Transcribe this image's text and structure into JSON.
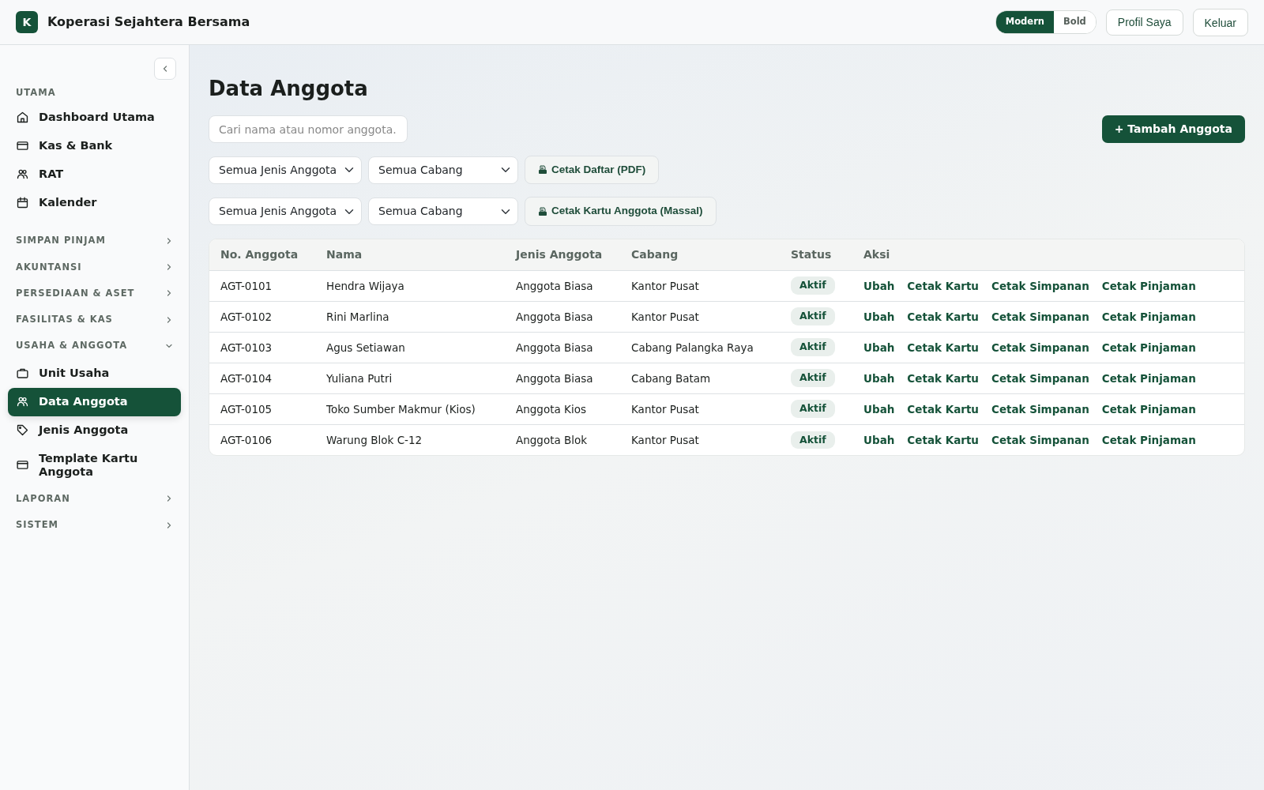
{
  "app": {
    "logo_letter": "K",
    "title": "Koperasi Sejahtera Bersama"
  },
  "theme_toggle": [
    {
      "label": "Modern",
      "selected": true
    },
    {
      "label": "Bold",
      "selected": false
    }
  ],
  "header_buttons": [
    "Profil Saya",
    "Keluar"
  ],
  "sidebar": {
    "sections": [
      {
        "title": "UTAMA",
        "kind": "plain",
        "items": [
          {
            "label": "Dashboard Utama",
            "selected": false
          },
          {
            "label": "Kas & Bank",
            "selected": false
          },
          {
            "label": "RAT",
            "selected": false
          },
          {
            "label": "Kalender",
            "selected": false
          }
        ]
      },
      {
        "title": "SIMPAN PINJAM",
        "kind": "group",
        "expanded": false
      },
      {
        "title": "AKUNTANSI",
        "kind": "group",
        "expanded": false
      },
      {
        "title": "PERSEDIAAN & ASET",
        "kind": "group",
        "expanded": false
      },
      {
        "title": "FASILITAS & KAS",
        "kind": "group",
        "expanded": false
      },
      {
        "title": "USAHA & ANGGOTA",
        "kind": "group",
        "expanded": true,
        "items": [
          {
            "label": "Unit Usaha",
            "selected": false
          },
          {
            "label": "Data Anggota",
            "selected": true
          },
          {
            "label": "Jenis Anggota",
            "selected": false
          },
          {
            "label": "Template Kartu Anggota",
            "selected": false
          }
        ]
      },
      {
        "title": "LAPORAN",
        "kind": "group",
        "expanded": false
      },
      {
        "title": "SISTEM",
        "kind": "group",
        "expanded": false
      }
    ]
  },
  "page_title": "Data Anggota",
  "search": {
    "placeholder": "Cari nama atau nomor anggota."
  },
  "add_button": "+ Tambah Anggota",
  "filter_rows": [
    {
      "selects": [
        "Semua Jenis Anggota",
        "Semua Cabang"
      ],
      "button": "Cetak Daftar (PDF)"
    },
    {
      "selects": [
        "Semua Jenis Anggota",
        "Semua Cabang"
      ],
      "button": "Cetak Kartu Anggota (Massal)"
    }
  ],
  "table": {
    "columns": [
      "No. Anggota",
      "Nama",
      "Jenis Anggota",
      "Cabang",
      "Status",
      "Aksi"
    ],
    "rows": [
      {
        "cells": [
          "AGT-0101",
          "Hendra Wijaya",
          "Anggota Biasa",
          "Kantor Pusat"
        ],
        "status": "Aktif",
        "actions": [
          "Ubah",
          "Cetak Kartu",
          "Cetak Simpanan",
          "Cetak Pinjaman"
        ]
      },
      {
        "cells": [
          "AGT-0102",
          "Rini Marlina",
          "Anggota Biasa",
          "Kantor Pusat"
        ],
        "status": "Aktif",
        "actions": [
          "Ubah",
          "Cetak Kartu",
          "Cetak Simpanan",
          "Cetak Pinjaman"
        ]
      },
      {
        "cells": [
          "AGT-0103",
          "Agus Setiawan",
          "Anggota Biasa",
          "Cabang Palangka Raya"
        ],
        "status": "Aktif",
        "actions": [
          "Ubah",
          "Cetak Kartu",
          "Cetak Simpanan",
          "Cetak Pinjaman"
        ]
      },
      {
        "cells": [
          "AGT-0104",
          "Yuliana Putri",
          "Anggota Biasa",
          "Cabang Batam"
        ],
        "status": "Aktif",
        "actions": [
          "Ubah",
          "Cetak Kartu",
          "Cetak Simpanan",
          "Cetak Pinjaman"
        ]
      },
      {
        "cells": [
          "AGT-0105",
          "Toko Sumber Makmur (Kios)",
          "Anggota Kios",
          "Kantor Pusat"
        ],
        "status": "Aktif",
        "actions": [
          "Ubah",
          "Cetak Kartu",
          "Cetak Simpanan",
          "Cetak Pinjaman"
        ]
      },
      {
        "cells": [
          "AGT-0106",
          "Warung Blok C-12",
          "Anggota Blok",
          "Kantor Pusat"
        ],
        "status": "Aktif",
        "actions": [
          "Ubah",
          "Cetak Kartu",
          "Cetak Simpanan",
          "Cetak Pinjaman"
        ]
      }
    ]
  }
}
